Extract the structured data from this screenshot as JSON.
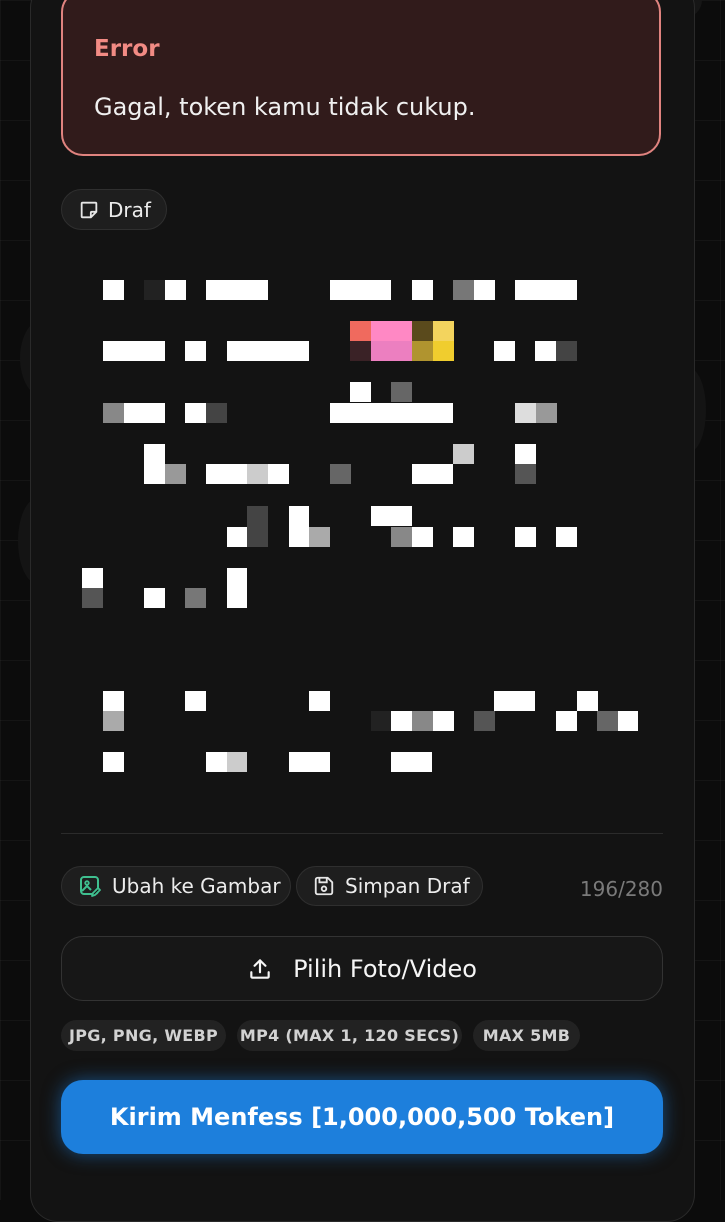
{
  "error": {
    "title": "Error",
    "message": "Gagal, token kamu tidak cukup."
  },
  "draft_chip": {
    "label": "Draf",
    "icon": "note-icon"
  },
  "composer": {
    "content_state": "redacted-pixelated",
    "char_count": "196/280"
  },
  "actions": {
    "to_image": {
      "label": "Ubah ke Gambar",
      "icon": "image-edit-icon"
    },
    "save_draft": {
      "label": "Simpan Draf",
      "icon": "floppy-disk-icon"
    }
  },
  "upload": {
    "label": "Pilih Foto/Video",
    "icon": "upload-icon"
  },
  "format_tags": [
    "JPG, PNG, WEBP",
    "MP4 (MAX 1, 120 SECS)",
    "MAX 5MB"
  ],
  "submit": {
    "label": "Kirim Menfess [1,000,000,500 Token]"
  },
  "colors": {
    "error_border": "#e0837f",
    "error_bg": "#311b1b",
    "error_title": "#f28b84",
    "accent": "#1d7fdc",
    "icon_green": "#3fbf8f"
  }
}
